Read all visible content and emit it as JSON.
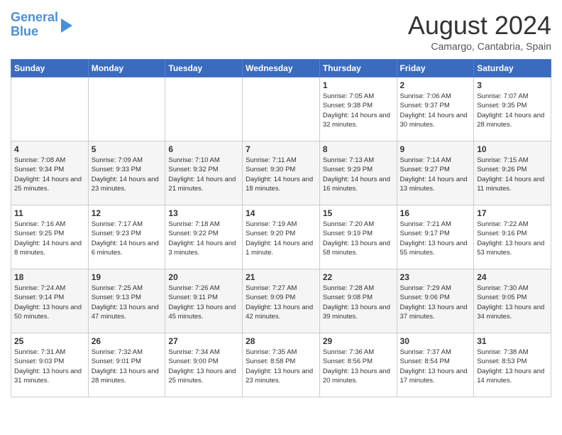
{
  "logo": {
    "line1": "General",
    "line2": "Blue"
  },
  "title": "August 2024",
  "location": "Camargo, Cantabria, Spain",
  "days_header": [
    "Sunday",
    "Monday",
    "Tuesday",
    "Wednesday",
    "Thursday",
    "Friday",
    "Saturday"
  ],
  "weeks": [
    [
      {
        "num": "",
        "sunrise": "",
        "sunset": "",
        "daylight": ""
      },
      {
        "num": "",
        "sunrise": "",
        "sunset": "",
        "daylight": ""
      },
      {
        "num": "",
        "sunrise": "",
        "sunset": "",
        "daylight": ""
      },
      {
        "num": "",
        "sunrise": "",
        "sunset": "",
        "daylight": ""
      },
      {
        "num": "1",
        "sunrise": "Sunrise: 7:05 AM",
        "sunset": "Sunset: 9:38 PM",
        "daylight": "Daylight: 14 hours and 32 minutes."
      },
      {
        "num": "2",
        "sunrise": "Sunrise: 7:06 AM",
        "sunset": "Sunset: 9:37 PM",
        "daylight": "Daylight: 14 hours and 30 minutes."
      },
      {
        "num": "3",
        "sunrise": "Sunrise: 7:07 AM",
        "sunset": "Sunset: 9:35 PM",
        "daylight": "Daylight: 14 hours and 28 minutes."
      }
    ],
    [
      {
        "num": "4",
        "sunrise": "Sunrise: 7:08 AM",
        "sunset": "Sunset: 9:34 PM",
        "daylight": "Daylight: 14 hours and 25 minutes."
      },
      {
        "num": "5",
        "sunrise": "Sunrise: 7:09 AM",
        "sunset": "Sunset: 9:33 PM",
        "daylight": "Daylight: 14 hours and 23 minutes."
      },
      {
        "num": "6",
        "sunrise": "Sunrise: 7:10 AM",
        "sunset": "Sunset: 9:32 PM",
        "daylight": "Daylight: 14 hours and 21 minutes."
      },
      {
        "num": "7",
        "sunrise": "Sunrise: 7:11 AM",
        "sunset": "Sunset: 9:30 PM",
        "daylight": "Daylight: 14 hours and 18 minutes."
      },
      {
        "num": "8",
        "sunrise": "Sunrise: 7:13 AM",
        "sunset": "Sunset: 9:29 PM",
        "daylight": "Daylight: 14 hours and 16 minutes."
      },
      {
        "num": "9",
        "sunrise": "Sunrise: 7:14 AM",
        "sunset": "Sunset: 9:27 PM",
        "daylight": "Daylight: 14 hours and 13 minutes."
      },
      {
        "num": "10",
        "sunrise": "Sunrise: 7:15 AM",
        "sunset": "Sunset: 9:26 PM",
        "daylight": "Daylight: 14 hours and 11 minutes."
      }
    ],
    [
      {
        "num": "11",
        "sunrise": "Sunrise: 7:16 AM",
        "sunset": "Sunset: 9:25 PM",
        "daylight": "Daylight: 14 hours and 8 minutes."
      },
      {
        "num": "12",
        "sunrise": "Sunrise: 7:17 AM",
        "sunset": "Sunset: 9:23 PM",
        "daylight": "Daylight: 14 hours and 6 minutes."
      },
      {
        "num": "13",
        "sunrise": "Sunrise: 7:18 AM",
        "sunset": "Sunset: 9:22 PM",
        "daylight": "Daylight: 14 hours and 3 minutes."
      },
      {
        "num": "14",
        "sunrise": "Sunrise: 7:19 AM",
        "sunset": "Sunset: 9:20 PM",
        "daylight": "Daylight: 14 hours and 1 minute."
      },
      {
        "num": "15",
        "sunrise": "Sunrise: 7:20 AM",
        "sunset": "Sunset: 9:19 PM",
        "daylight": "Daylight: 13 hours and 58 minutes."
      },
      {
        "num": "16",
        "sunrise": "Sunrise: 7:21 AM",
        "sunset": "Sunset: 9:17 PM",
        "daylight": "Daylight: 13 hours and 55 minutes."
      },
      {
        "num": "17",
        "sunrise": "Sunrise: 7:22 AM",
        "sunset": "Sunset: 9:16 PM",
        "daylight": "Daylight: 13 hours and 53 minutes."
      }
    ],
    [
      {
        "num": "18",
        "sunrise": "Sunrise: 7:24 AM",
        "sunset": "Sunset: 9:14 PM",
        "daylight": "Daylight: 13 hours and 50 minutes."
      },
      {
        "num": "19",
        "sunrise": "Sunrise: 7:25 AM",
        "sunset": "Sunset: 9:13 PM",
        "daylight": "Daylight: 13 hours and 47 minutes."
      },
      {
        "num": "20",
        "sunrise": "Sunrise: 7:26 AM",
        "sunset": "Sunset: 9:11 PM",
        "daylight": "Daylight: 13 hours and 45 minutes."
      },
      {
        "num": "21",
        "sunrise": "Sunrise: 7:27 AM",
        "sunset": "Sunset: 9:09 PM",
        "daylight": "Daylight: 13 hours and 42 minutes."
      },
      {
        "num": "22",
        "sunrise": "Sunrise: 7:28 AM",
        "sunset": "Sunset: 9:08 PM",
        "daylight": "Daylight: 13 hours and 39 minutes."
      },
      {
        "num": "23",
        "sunrise": "Sunrise: 7:29 AM",
        "sunset": "Sunset: 9:06 PM",
        "daylight": "Daylight: 13 hours and 37 minutes."
      },
      {
        "num": "24",
        "sunrise": "Sunrise: 7:30 AM",
        "sunset": "Sunset: 9:05 PM",
        "daylight": "Daylight: 13 hours and 34 minutes."
      }
    ],
    [
      {
        "num": "25",
        "sunrise": "Sunrise: 7:31 AM",
        "sunset": "Sunset: 9:03 PM",
        "daylight": "Daylight: 13 hours and 31 minutes."
      },
      {
        "num": "26",
        "sunrise": "Sunrise: 7:32 AM",
        "sunset": "Sunset: 9:01 PM",
        "daylight": "Daylight: 13 hours and 28 minutes."
      },
      {
        "num": "27",
        "sunrise": "Sunrise: 7:34 AM",
        "sunset": "Sunset: 9:00 PM",
        "daylight": "Daylight: 13 hours and 25 minutes."
      },
      {
        "num": "28",
        "sunrise": "Sunrise: 7:35 AM",
        "sunset": "Sunset: 8:58 PM",
        "daylight": "Daylight: 13 hours and 23 minutes."
      },
      {
        "num": "29",
        "sunrise": "Sunrise: 7:36 AM",
        "sunset": "Sunset: 8:56 PM",
        "daylight": "Daylight: 13 hours and 20 minutes."
      },
      {
        "num": "30",
        "sunrise": "Sunrise: 7:37 AM",
        "sunset": "Sunset: 8:54 PM",
        "daylight": "Daylight: 13 hours and 17 minutes."
      },
      {
        "num": "31",
        "sunrise": "Sunrise: 7:38 AM",
        "sunset": "Sunset: 8:53 PM",
        "daylight": "Daylight: 13 hours and 14 minutes."
      }
    ]
  ]
}
